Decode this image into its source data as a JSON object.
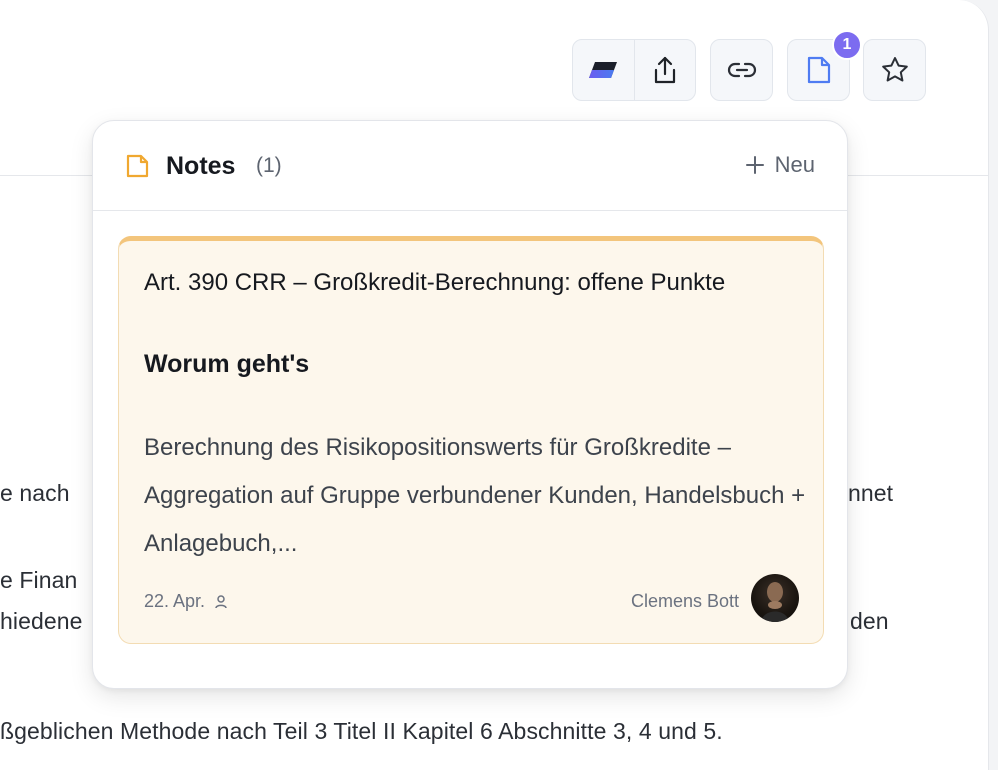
{
  "toolbar": {
    "notes_badge_count": "1",
    "accent_color": "#7c6cf0"
  },
  "background_text": {
    "line1_left": "e nach",
    "line1_right": "nnet",
    "line2_left": "e Finan",
    "line3_left": "hiedene",
    "line3_right": "den",
    "line4": "ßgeblichen Methode nach Teil 3 Titel II Kapitel 6 Abschnitte 3, 4 und 5."
  },
  "notes_popup": {
    "title": "Notes",
    "count": "(1)",
    "new_label": "Neu",
    "notes": [
      {
        "title": "Art. 390 CRR – Großkredit-Berechnung: offene Punkte",
        "heading": "Worum geht's",
        "body": "Berechnung des Risikopositionswerts für Großkredite – Aggregation auf Gruppe verbundener Kunden, Handelsbuch + Anlagebuch,...",
        "date": "22. Apr.",
        "author": "Clemens Bott",
        "card_color": "#fdf7ec",
        "accent_color": "#f3c57c"
      }
    ]
  }
}
